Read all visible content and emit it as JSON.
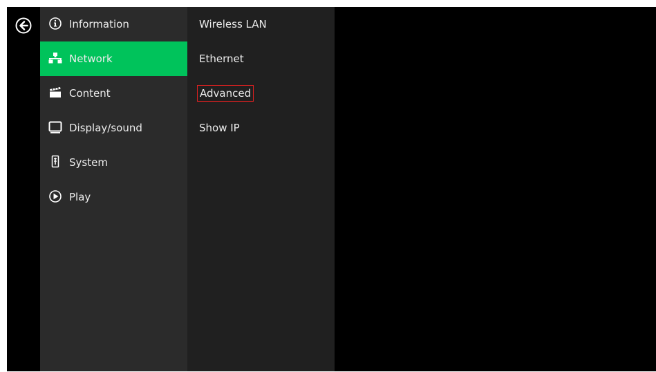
{
  "main_menu": {
    "items": [
      {
        "label": "Information",
        "icon": "info-icon"
      },
      {
        "label": "Network",
        "icon": "network-icon",
        "active": true
      },
      {
        "label": "Content",
        "icon": "clapperboard-icon"
      },
      {
        "label": "Display/sound",
        "icon": "monitor-icon"
      },
      {
        "label": "System",
        "icon": "system-icon"
      },
      {
        "label": "Play",
        "icon": "play-icon"
      }
    ]
  },
  "sub_menu": {
    "items": [
      {
        "label": "Wireless LAN"
      },
      {
        "label": "Ethernet"
      },
      {
        "label": "Advanced",
        "highlighted": true
      },
      {
        "label": "Show IP"
      }
    ]
  },
  "colors": {
    "accent": "#00c35b",
    "highlight_border": "#e02020",
    "panel": "#2b2b2b",
    "subpanel": "#202020",
    "background": "#000000"
  }
}
